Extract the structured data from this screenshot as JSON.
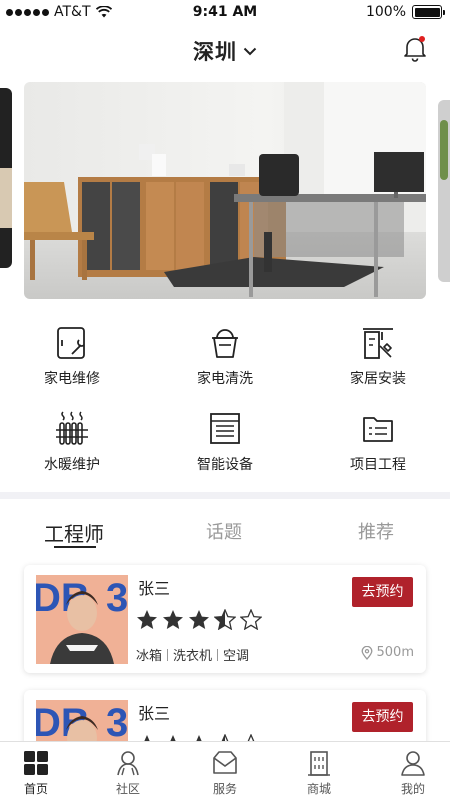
{
  "status": {
    "carrier": "AT&T",
    "time": "9:41 AM",
    "battery": "100%"
  },
  "header": {
    "city": "深圳"
  },
  "services": [
    {
      "label": "家电维修",
      "icon": "appliance-repair-icon"
    },
    {
      "label": "家电清洗",
      "icon": "bucket-icon"
    },
    {
      "label": "家居安装",
      "icon": "door-install-icon"
    },
    {
      "label": "水暖维护",
      "icon": "radiator-icon"
    },
    {
      "label": "智能设备",
      "icon": "smart-device-icon"
    },
    {
      "label": "项目工程",
      "icon": "folder-icon"
    }
  ],
  "tabs": [
    {
      "label": "工程师"
    },
    {
      "label": "话题"
    },
    {
      "label": "推荐"
    }
  ],
  "engineers": [
    {
      "name": "张三",
      "rating": 3.5,
      "max_rating": 5,
      "skills": [
        "冰箱",
        "洗衣机",
        "空调"
      ],
      "distance": "500m",
      "book_label": "去预约"
    },
    {
      "name": "张三",
      "rating": 3.5,
      "max_rating": 5,
      "skills": [],
      "distance": "",
      "book_label": "去预约"
    }
  ],
  "tabbar": [
    {
      "label": "首页",
      "icon": "home-grid-icon",
      "active": true
    },
    {
      "label": "社区",
      "icon": "community-icon",
      "active": false
    },
    {
      "label": "服务",
      "icon": "service-icon",
      "active": false
    },
    {
      "label": "商城",
      "icon": "mall-icon",
      "active": false
    },
    {
      "label": "我的",
      "icon": "profile-icon",
      "active": false
    }
  ],
  "colors": {
    "accent": "#b0222b",
    "text": "#222222",
    "muted": "#999999",
    "notify_dot": "#e02020"
  }
}
